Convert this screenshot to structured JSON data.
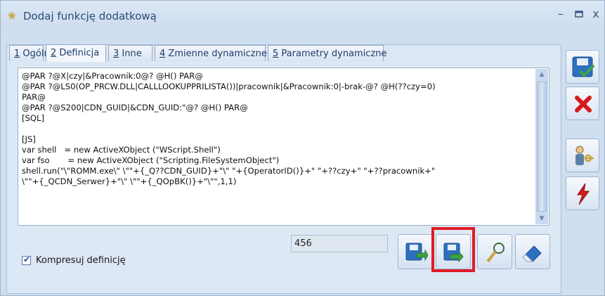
{
  "window": {
    "title": "Dodaj funkcję dodatkową",
    "icon": "glasses-icon",
    "controls": [
      "–",
      "▫",
      "x"
    ]
  },
  "tabs": [
    {
      "key": "1",
      "label": " Ogólne",
      "active": false
    },
    {
      "key": "2",
      "label": " Definicja",
      "active": true
    },
    {
      "key": "3",
      "label": " Inne",
      "active": false
    },
    {
      "key": "4",
      "label": " Zmienne dynamiczne",
      "active": false
    },
    {
      "key": "5",
      "label": " Parametry dynamiczne",
      "active": false
    }
  ],
  "editor": {
    "code": "@PAR ?@X|czy|&Pracownik:0@? @H() PAR@\n@PAR ?@LS0(OP_PRCW.DLL|CALLLOOKUPPRILISTA())|pracownik|&Pracownik:0|-brak-@? @H(??czy=0)\nPAR@\n@PAR ?@S200|CDN_GUID|&CDN_GUID:\"@? @H() PAR@\n[SQL]\n\n[JS]\nvar shell   = new ActiveXObject (\"WScript.Shell\")\nvar fso       = new ActiveXObject (\"Scripting.FileSystemObject\")\nshell.run(\"\\\"ROMM.exe\\\" \\\"\"+{_Q??CDN_GUID}+\"\\\" \"+{OperatorID()}+\" \"+??czy+\" \"+??pracownik+\"\n\\\"\"+{_QCDN_Serwer}+\"\\\" \\\"\"+{_QOpBK()}+\"\\\"\",1,1)"
  },
  "number_field": {
    "value": "456"
  },
  "compress_checkbox": {
    "label": "Kompresuj definicję",
    "checked": true
  },
  "toolbar": {
    "buttons": [
      "import-icon",
      "export-icon",
      "magnifier-icon",
      "eraser-icon"
    ],
    "highlighted": "export-icon"
  },
  "sidebar": {
    "buttons": [
      "save-icon",
      "cancel-icon",
      "user-key-icon",
      "lightning-icon"
    ]
  },
  "colors": {
    "highlight_border": "#e01b24",
    "panel_bg": "#dbe7f5",
    "title_text": "#2b4a78"
  }
}
